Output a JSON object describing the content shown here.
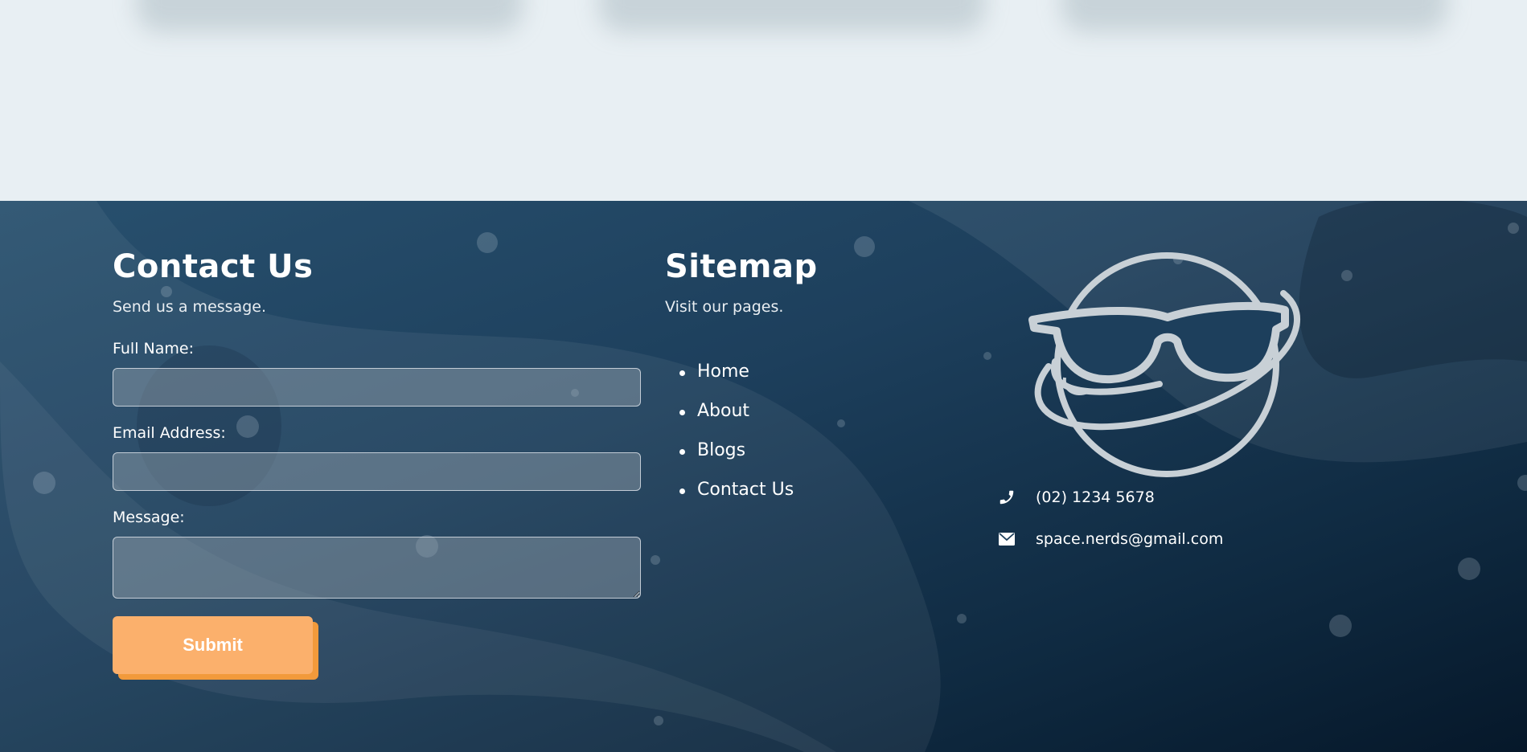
{
  "contact": {
    "title": "Contact Us",
    "subtitle": "Send us a message.",
    "full_name_label": "Full Name:",
    "full_name_value": "",
    "email_label": "Email Address:",
    "email_value": "",
    "message_label": "Message:",
    "message_value": "",
    "submit_label": "Submit"
  },
  "sitemap": {
    "title": "Sitemap",
    "subtitle": "Visit our pages.",
    "links": [
      {
        "label": "Home"
      },
      {
        "label": "About"
      },
      {
        "label": "Blogs"
      },
      {
        "label": "Contact Us"
      }
    ]
  },
  "info": {
    "logo_icon": "planet-sunglasses-logo",
    "phone": "(02) 1234 5678",
    "phone_icon": "phone-icon",
    "email": "space.nerds@gmail.com",
    "email_icon": "envelope-icon"
  },
  "colors": {
    "footer_dark": "#0f2a41",
    "accent": "#fbb06c",
    "accent_shadow": "#f29a3b",
    "page_background": "#e8eff3"
  }
}
